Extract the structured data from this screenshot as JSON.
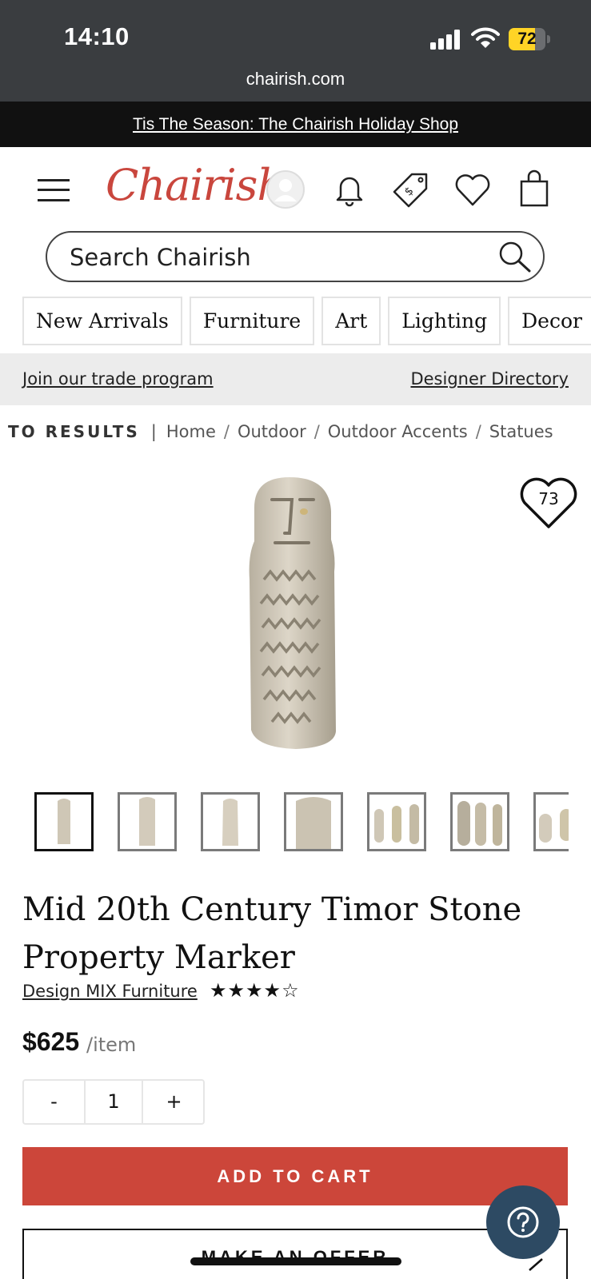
{
  "status_bar": {
    "time": "14:10",
    "battery_level": "72",
    "battery_fraction": 0.72,
    "url": "chairish.com"
  },
  "promo": {
    "text": "Tis The Season: The Chairish Holiday Shop"
  },
  "header": {
    "logo": "Chairish",
    "icons": [
      "menu-icon",
      "account-icon",
      "bell-icon",
      "price-tag-icon",
      "heart-icon",
      "shopping-bag-icon"
    ]
  },
  "search": {
    "placeholder": "Search Chairish"
  },
  "categories": [
    "New Arrivals",
    "Furniture",
    "Art",
    "Lighting",
    "Decor"
  ],
  "trade": {
    "join": "Join our trade program",
    "directory": "Designer Directory"
  },
  "breadcrumb": {
    "back": "TO RESULTS",
    "separator": "|",
    "items": [
      "Home",
      "Outdoor",
      "Outdoor Accents",
      "Statues"
    ]
  },
  "favorite": {
    "count": "73"
  },
  "product": {
    "title": "Mid 20th Century Timor Stone Property Marker",
    "seller": "Design MIX Furniture",
    "stars": "★★★★☆",
    "rating": 4,
    "price": "$625",
    "unit": "/item",
    "quantity": "1",
    "minus": "-",
    "plus": "+",
    "add_to_cart": "ADD TO CART",
    "make_offer": "MAKE AN OFFER"
  },
  "colors": {
    "brand_red": "#c9463d",
    "add_to_cart": "#cc463a",
    "help_button": "#2d4a63",
    "promo_bg": "#111111",
    "status_bg": "#3a3d40"
  }
}
